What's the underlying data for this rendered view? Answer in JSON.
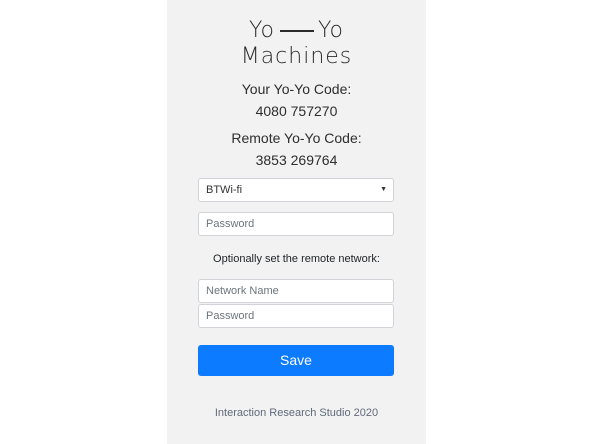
{
  "logo": {
    "word1": "Yo",
    "word2": "Yo",
    "word3": "Machines"
  },
  "your_code": {
    "label": "Your Yo-Yo Code:",
    "value": "4080 757270"
  },
  "remote_code": {
    "label": "Remote Yo-Yo Code:",
    "value": "3853 269764"
  },
  "network_select": {
    "selected": "BTWi-fi",
    "arrow_icon": "caret-down-icon"
  },
  "password": {
    "placeholder": "Password"
  },
  "remote_network": {
    "note": "Optionally set the remote network:",
    "name_placeholder": "Network Name",
    "password_placeholder": "Password"
  },
  "save_button": {
    "label": "Save",
    "color": "#0d7bff"
  },
  "footer": {
    "text": "Interaction Research Studio 2020"
  }
}
